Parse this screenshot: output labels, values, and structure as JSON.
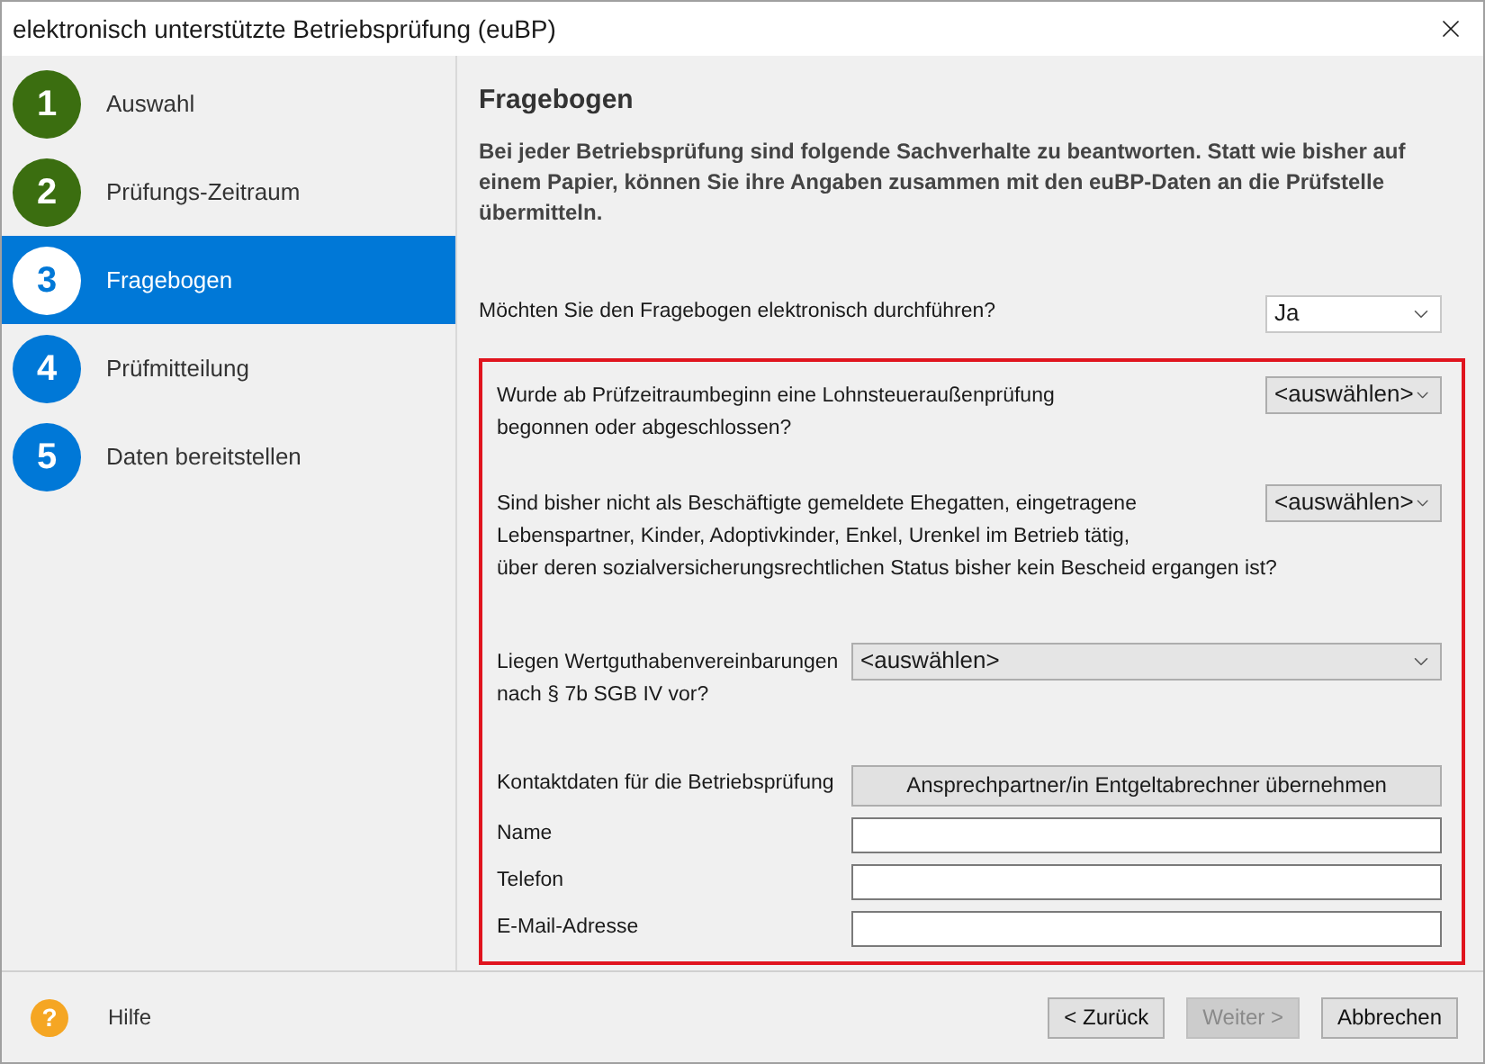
{
  "window": {
    "title": "elektronisch unterstützte Betriebsprüfung (euBP)"
  },
  "steps": [
    {
      "number": "1",
      "label": "Auswahl",
      "kind": "done",
      "selected": false
    },
    {
      "number": "2",
      "label": "Prüfungs-Zeitraum",
      "kind": "done",
      "selected": false
    },
    {
      "number": "3",
      "label": "Fragebogen",
      "kind": "current",
      "selected": true
    },
    {
      "number": "4",
      "label": "Prüfmitteilung",
      "kind": "pending",
      "selected": false
    },
    {
      "number": "5",
      "label": "Daten bereitstellen",
      "kind": "pending",
      "selected": false
    }
  ],
  "main": {
    "heading": "Fragebogen",
    "intro": "Bei jeder Betriebsprüfung sind folgende Sachverhalte zu beantworten. Statt wie bisher auf einem Papier, können Sie ihre Angaben zusammen mit den euBP-Daten an die Prüfstelle übermitteln.",
    "electronic_question": {
      "label": "Möchten Sie den Fragebogen elektronisch durchführen?",
      "value": "Ja"
    },
    "highlighted_section": {
      "questions": [
        {
          "kind": "narrow",
          "lines": [
            "Wurde ab Prüfzeitraumbeginn eine Lohnsteueraußenprüfung",
            "begonnen oder abgeschlossen?"
          ],
          "value": "<auswählen>"
        },
        {
          "kind": "narrow",
          "lines": [
            "Sind bisher nicht als Beschäftigte gemeldete Ehegatten, eingetragene",
            "Lebenspartner, Kinder, Adoptivkinder, Enkel, Urenkel im Betrieb tätig,",
            "über deren sozialversicherungsrechtlichen Status bisher kein Bescheid ergangen ist?"
          ],
          "value": "<auswählen>"
        },
        {
          "kind": "wide",
          "lines": [
            "Liegen Wertguthabenvereinbarungen",
            "nach § 7b SGB IV vor?"
          ],
          "value": "<auswählen>"
        }
      ],
      "contact": {
        "label": "Kontaktdaten für die Betriebsprüfung",
        "button": "Ansprechpartner/in Entgeltabrechner übernehmen"
      },
      "fields": [
        {
          "label": "Name"
        },
        {
          "label": "Telefon"
        },
        {
          "label": "E-Mail-Adresse"
        }
      ]
    }
  },
  "footer": {
    "help": "Hilfe",
    "help_icon": "?",
    "buttons": [
      {
        "label": "< Zurück",
        "disabled": false
      },
      {
        "label": "Weiter >",
        "disabled": true
      },
      {
        "label": "Abbrechen",
        "disabled": false
      }
    ]
  }
}
